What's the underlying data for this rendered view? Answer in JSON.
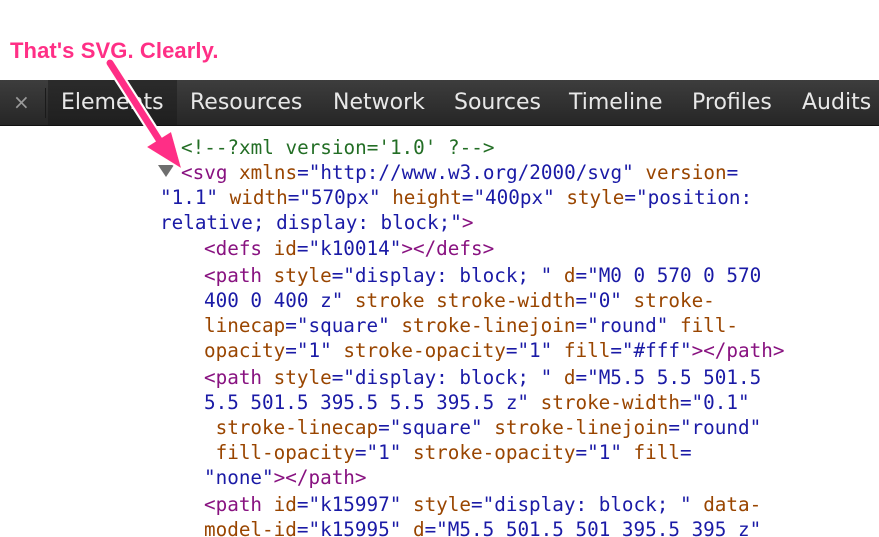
{
  "annotation": {
    "caption": "That's SVG. Clearly."
  },
  "toolbar": {
    "close": "×",
    "tabs": [
      "Elements",
      "Resources",
      "Network",
      "Sources",
      "Timeline",
      "Profiles",
      "Audits"
    ]
  },
  "code": {
    "l0": {
      "comment": "<!--?xml version='1.0' ?-->"
    },
    "l1": {
      "a": "<svg ",
      "b": "xmlns",
      "c": "=\"",
      "d": "http://www.w3.org/2000/svg",
      "e": "\" ",
      "f": "version",
      "g": "="
    },
    "l2": {
      "a": "\"1.1\" ",
      "b": "width",
      "c": "=\"570px\" ",
      "d": "height",
      "e": "=\"400px\" ",
      "f": "style",
      "g": "=\"position:"
    },
    "l3": {
      "a": "relative; display: block;\"",
      "b": ">"
    },
    "l4": {
      "a": "<defs ",
      "b": "id",
      "c": "=\"k10014\"",
      "d": "></defs>"
    },
    "l5": {
      "a": "<path ",
      "b": "style",
      "c": "=\"display: block; \" ",
      "d": "d",
      "e": "=\"M0 0 570 0 570"
    },
    "l6": {
      "a": "400 0 400 z\" ",
      "b": "stroke stroke-width",
      "c": "=\"0\" ",
      "d": "stroke-"
    },
    "l7": {
      "a": "linecap",
      "b": "=\"square\" ",
      "c": "stroke-linejoin",
      "d": "=\"round\" ",
      "e": "fill-"
    },
    "l8": {
      "a": "opacity",
      "b": "=\"1\" ",
      "c": "stroke-opacity",
      "d": "=\"1\" ",
      "e": "fill",
      "f": "=\"#fff\"",
      "g": "></path>"
    },
    "l9": {
      "a": "<path ",
      "b": "style",
      "c": "=\"display: block; \" ",
      "d": "d",
      "e": "=\"M5.5 5.5 501.5"
    },
    "l10": {
      "a": "5.5 501.5 395.5 5.5 395.5 z\" ",
      "b": "stroke-width",
      "c": "=\"0.1\""
    },
    "l11": {
      "a": " stroke-linecap",
      "b": "=\"square\" ",
      "c": "stroke-linejoin",
      "d": "=\"round\""
    },
    "l12": {
      "a": " fill-opacity",
      "b": "=\"1\" ",
      "c": "stroke-opacity",
      "d": "=\"1\" ",
      "e": "fill",
      "f": "="
    },
    "l13": {
      "a": "\"none\"",
      "b": "></path>"
    },
    "l14": {
      "a": "<path ",
      "b": "id",
      "c": "=\"k15997\" ",
      "d": "style",
      "e": "=\"display: block; \" ",
      "f": "data-"
    },
    "l15": {
      "a": "model-id",
      "b": "=\"k15995\" ",
      "c": "d",
      "d": "=\"M5.5 501.5 501 395.5 395 z\""
    }
  },
  "colors": {
    "accent_annotation": "#ff2f86",
    "tag": "#881280",
    "attribute": "#994500",
    "value": "#1a1aa6",
    "comment": "#236e25",
    "toolbar_bg": "#2f2f2f"
  }
}
